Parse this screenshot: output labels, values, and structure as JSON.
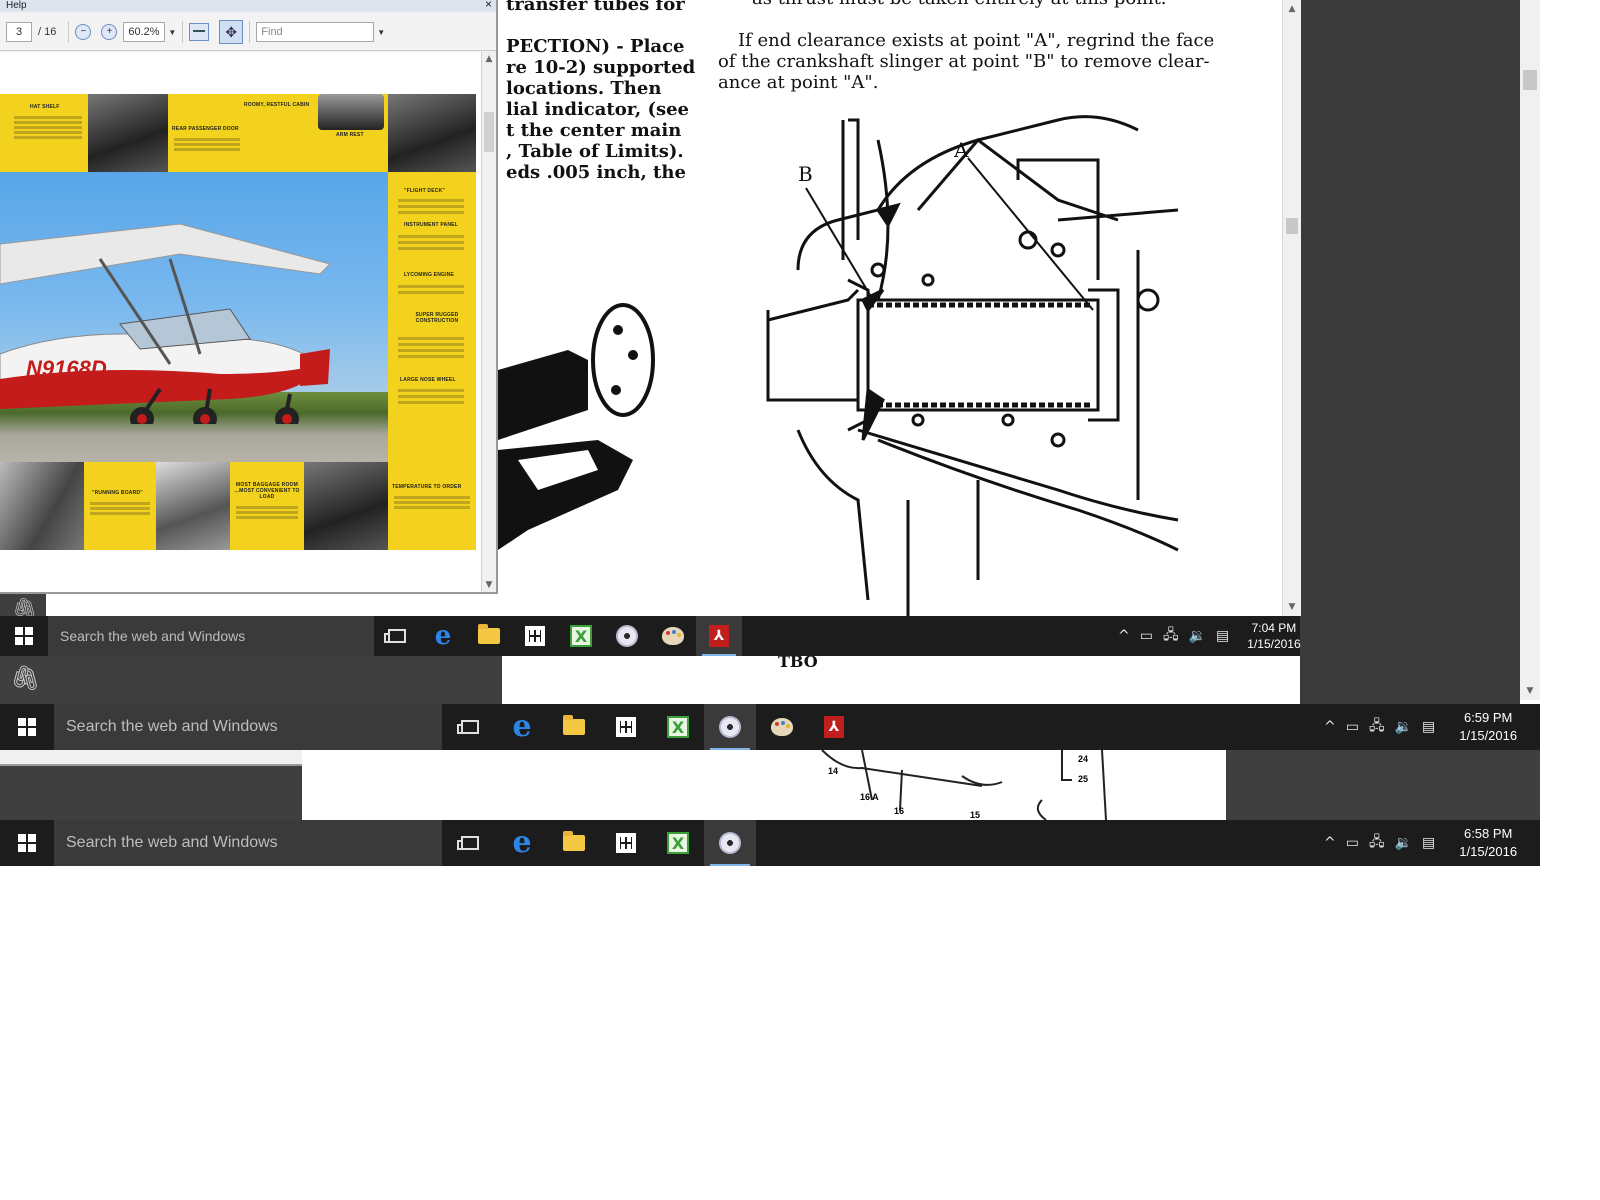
{
  "acrobat_small": {
    "menu_label": "Help",
    "close_glyph": "×",
    "page_current": "3",
    "page_total": "/ 16",
    "zoom": "60.2%",
    "find_placeholder": "Find",
    "brochure": {
      "registration": "N9168D",
      "captions": [
        {
          "title": "Hat Shelf"
        },
        {
          "title": "Rear Passenger Door"
        },
        {
          "title": "Roomy, Restful Cabin"
        },
        {
          "title": "Arm Rest"
        },
        {
          "title": "\"Flight Deck\""
        },
        {
          "title": "Instrument Panel"
        },
        {
          "title": "Lycoming Engine"
        },
        {
          "title": "Super Rugged Construction"
        },
        {
          "title": "Large Nose Wheel"
        },
        {
          "title": "\"Running Board\""
        },
        {
          "title": "Most Baggage Room ...Most Convenient to Load"
        },
        {
          "title": "Temperature to Order"
        }
      ]
    }
  },
  "manual_page": {
    "left_lines": [
      "transfer tubes for",
      "",
      "PECTION) - Place",
      "re 10-2) supported",
      "locations.  Then",
      "lial indicator, (see",
      "t the center main",
      ", Table of Limits).",
      "eds .005 inch, the"
    ],
    "right_top": "as thrust must be taken entirely at this point.",
    "right_para": [
      "If end clearance exists at point \"A\", regrind the face",
      "of the crankshaft slinger at point \"B\" to remove clear-",
      "ance at point \"A\"."
    ],
    "label_a": "A",
    "label_b": "B"
  },
  "back_page": {
    "fragment": "TBO",
    "diagram_labels": [
      "14",
      "16 A",
      "16",
      "15",
      "24",
      "25"
    ]
  },
  "taskbars": [
    {
      "search_placeholder": "Search the web and Windows",
      "time": "7:04 PM",
      "date": "1/15/2016",
      "apps": [
        "task-view",
        "edge",
        "file-explorer",
        "store",
        "green-app",
        "disc",
        "paint",
        "acrobat"
      ]
    },
    {
      "search_placeholder": "Search the web and Windows",
      "time": "6:59 PM",
      "date": "1/15/2016",
      "apps": [
        "task-view",
        "edge",
        "file-explorer",
        "store",
        "green-app",
        "disc",
        "paint",
        "acrobat"
      ]
    },
    {
      "search_placeholder": "Search the web and Windows",
      "time": "6:58 PM",
      "date": "1/15/2016",
      "apps": [
        "task-view",
        "edge",
        "file-explorer",
        "store",
        "green-app",
        "disc"
      ]
    }
  ],
  "colors": {
    "taskbar": "#1c1c1c",
    "search_box": "#3a3a3a",
    "brochure_yellow": "#f2d21c",
    "sky_blue": "#58a6e8",
    "plane_red": "#c41b1b"
  }
}
